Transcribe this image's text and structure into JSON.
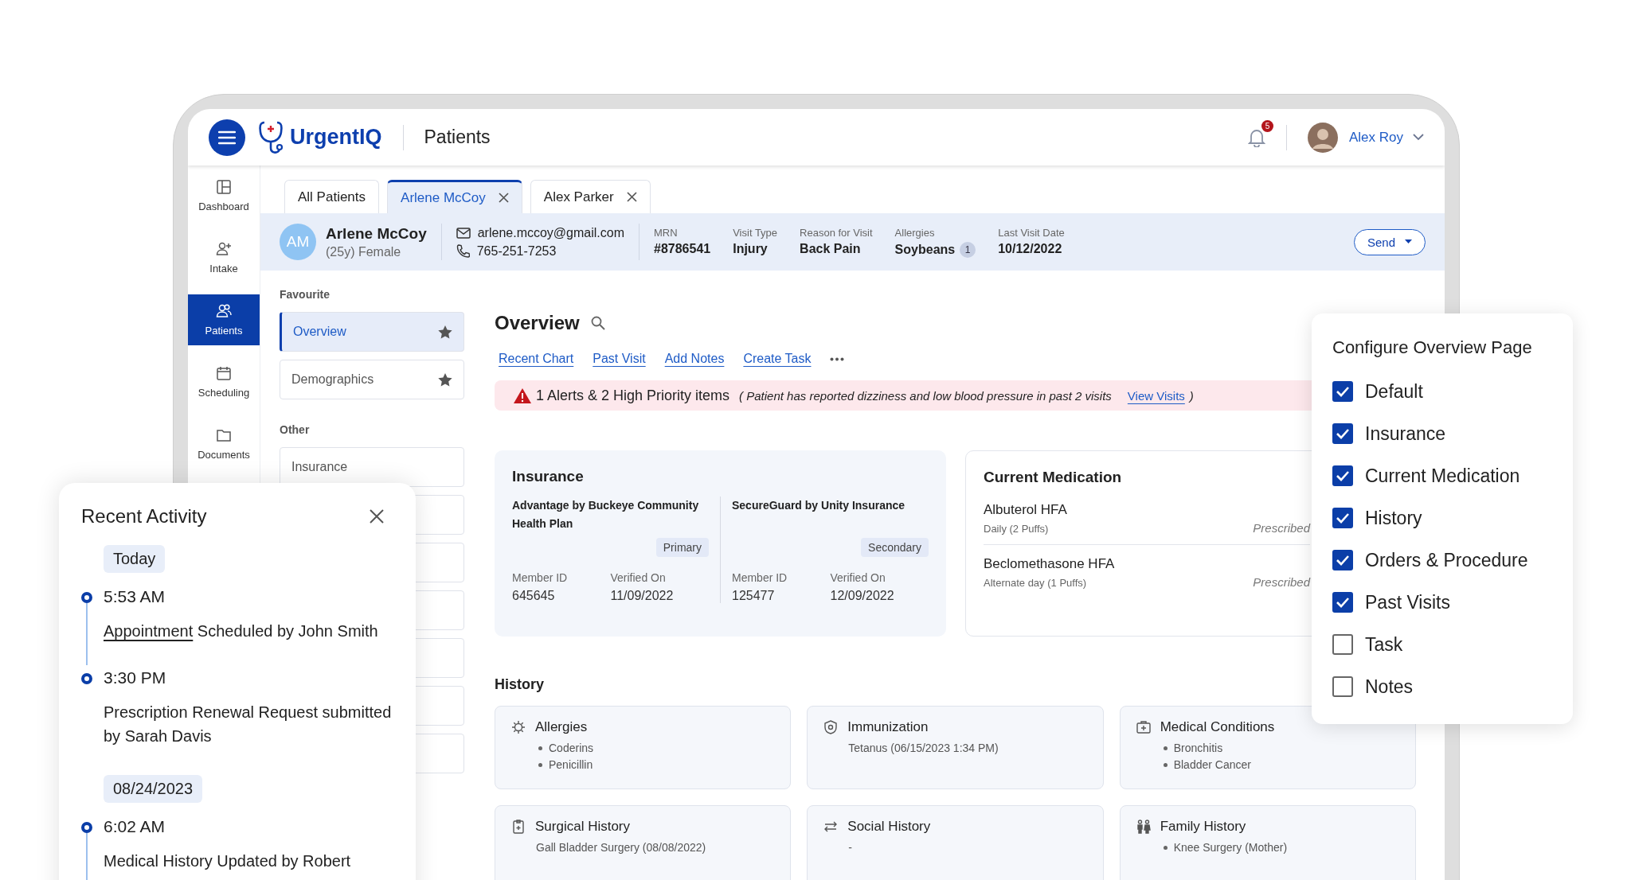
{
  "header": {
    "app_name": "UrgentIQ",
    "page_title": "Patients",
    "notification_count": "5",
    "user_name": "Alex Roy"
  },
  "nav": [
    {
      "label": "Dashboard",
      "selected": false
    },
    {
      "label": "Intake",
      "selected": false
    },
    {
      "label": "Patients",
      "selected": true
    },
    {
      "label": "Scheduling",
      "selected": false
    },
    {
      "label": "Documents",
      "selected": false
    }
  ],
  "tabs": [
    {
      "label": "All Patients",
      "selected": false,
      "closable": false
    },
    {
      "label": "Arlene McCoy",
      "selected": true,
      "closable": true
    },
    {
      "label": "Alex Parker",
      "selected": false,
      "closable": true
    }
  ],
  "patient": {
    "initials": "AM",
    "name": "Arlene McCoy",
    "age_sex": "(25y) Female",
    "email": "arlene.mccoy@gmail.com",
    "phone": "765-251-7253",
    "fields": [
      {
        "label": "MRN",
        "value": "#8786541"
      },
      {
        "label": "Visit Type",
        "value": "Injury"
      },
      {
        "label": "Reason for Visit",
        "value": "Back Pain"
      },
      {
        "label": "Allergies",
        "value": "Soybeans",
        "count": "1"
      },
      {
        "label": "Last Visit Date",
        "value": "10/12/2022"
      }
    ],
    "send_button": "Send"
  },
  "submenu": {
    "favourite_heading": "Favourite",
    "favourites": [
      {
        "label": "Overview",
        "selected": true
      },
      {
        "label": "Demographics",
        "selected": false
      }
    ],
    "other_heading": "Other",
    "others": [
      "Insurance"
    ]
  },
  "overview": {
    "title": "Overview",
    "links": [
      "Recent Chart",
      "Past Visit",
      "Add Notes",
      "Create Task"
    ],
    "alert": {
      "headline": "1 Alerts & 2 High Priority items",
      "detail": "( Patient has reported dizziness and low blood pressure in past 2 visits",
      "link": "View Visits",
      "end": ")"
    }
  },
  "insurance": {
    "title": "Insurance",
    "plans": [
      {
        "name": "Advantage by Buckeye Community Health Plan",
        "rank": "Primary",
        "member_id_label": "Member ID",
        "member_id": "645645",
        "verified_label": "Verified On",
        "verified": "11/09/2022"
      },
      {
        "name": "SecureGuard by Unity Insurance",
        "rank": "Secondary",
        "member_id_label": "Member ID",
        "member_id": "125477",
        "verified_label": "Verified On",
        "verified": "12/09/2022"
      }
    ]
  },
  "medication": {
    "title": "Current Medication",
    "items": [
      {
        "name": "Albuterol HFA",
        "dose": "Daily (2 Puffs)",
        "status": "Prescribed"
      },
      {
        "name": "Beclomethasone HFA",
        "dose": "Alternate day  (1 Puffs)",
        "status": "Prescribed"
      }
    ]
  },
  "history": {
    "title": "History",
    "cards": [
      {
        "title": "Allergies",
        "kind": "list",
        "items": [
          "Coderins",
          "Penicillin"
        ]
      },
      {
        "title": "Immunization",
        "kind": "text",
        "items": [
          "Tetanus (06/15/2023 1:34 PM)"
        ]
      },
      {
        "title": "Medical Conditions",
        "kind": "list",
        "items": [
          "Bronchitis",
          "Bladder Cancer"
        ]
      },
      {
        "title": "Surgical History",
        "kind": "text",
        "items": [
          "Gall Bladder Surgery (08/08/2022)"
        ]
      },
      {
        "title": "Social History",
        "kind": "text",
        "items": [
          "-"
        ]
      },
      {
        "title": "Family History",
        "kind": "list",
        "items": [
          "Knee Surgery (Mother)"
        ]
      }
    ]
  },
  "configure": {
    "title": "Configure Overview Page",
    "options": [
      {
        "label": "Default",
        "checked": true
      },
      {
        "label": "Insurance",
        "checked": true
      },
      {
        "label": "Current Medication",
        "checked": true
      },
      {
        "label": "History",
        "checked": true
      },
      {
        "label": "Orders & Procedure",
        "checked": true
      },
      {
        "label": "Past Visits",
        "checked": true
      },
      {
        "label": "Task",
        "checked": false
      },
      {
        "label": "Notes",
        "checked": false
      }
    ]
  },
  "recent_activity": {
    "title": "Recent Activity",
    "groups": [
      {
        "date": "Today",
        "events": [
          {
            "time": "5:53 AM",
            "link": "Appointment",
            "text": "Scheduled by John Smith"
          },
          {
            "time": "3:30 PM",
            "text": "Prescription Renewal Request submitted by Sarah Davis"
          }
        ]
      },
      {
        "date": "08/24/2023",
        "events": [
          {
            "time": "6:02 AM",
            "text": "Medical History Updated by Robert"
          }
        ]
      }
    ]
  }
}
